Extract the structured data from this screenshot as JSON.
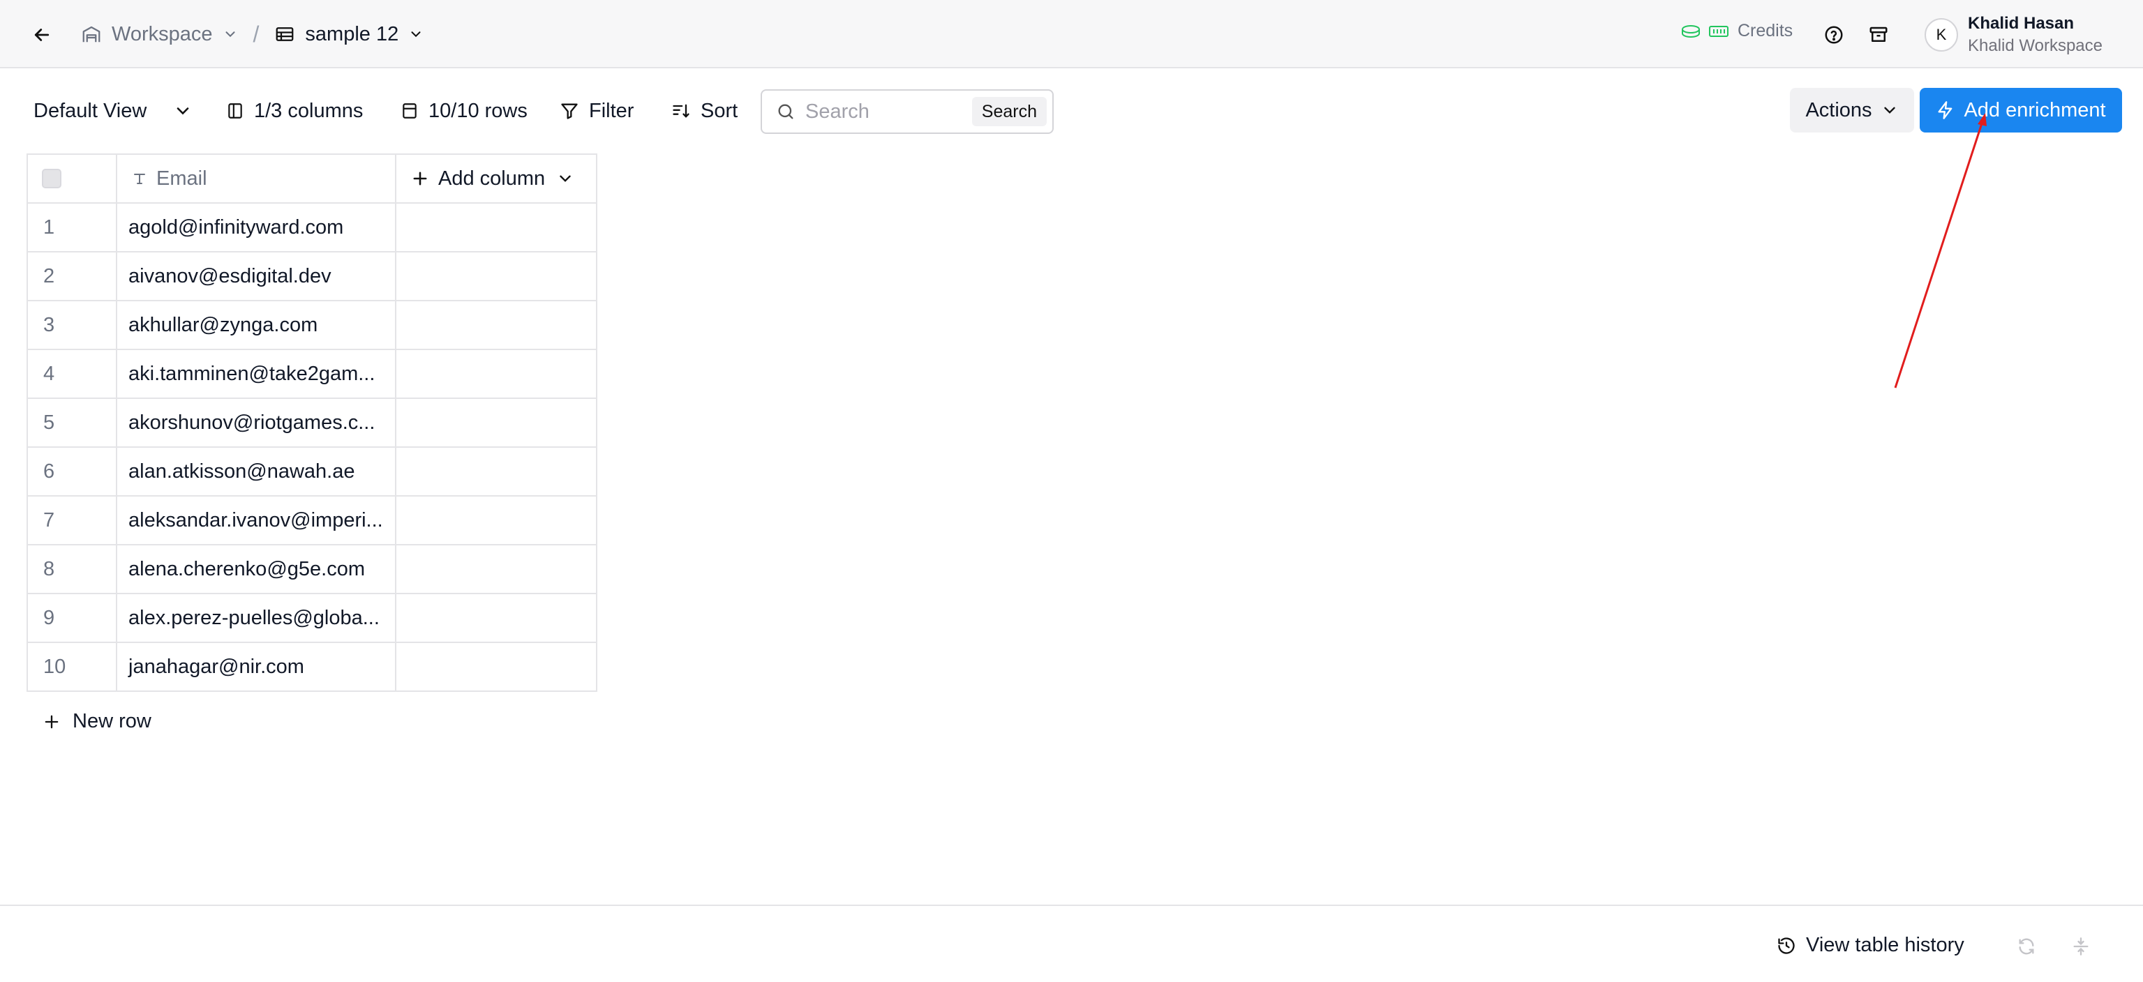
{
  "header": {
    "breadcrumb": {
      "workspace_label": "Workspace",
      "separator": "/",
      "table_label": "sample 12"
    },
    "credits_label": "Credits",
    "user": {
      "initial": "K",
      "name": "Khalid Hasan",
      "workspace": "Khalid Workspace"
    }
  },
  "toolbar": {
    "view_label": "Default View",
    "columns_label": "1/3 columns",
    "rows_label": "10/10 rows",
    "filter_label": "Filter",
    "sort_label": "Sort",
    "search_placeholder": "Search",
    "search_button_label": "Search",
    "actions_label": "Actions",
    "enrich_label": "Add enrichment"
  },
  "table": {
    "email_header": "Email",
    "add_column_label": "Add column",
    "rows": [
      {
        "num": "1",
        "email": "agold@infinityward.com"
      },
      {
        "num": "2",
        "email": "aivanov@esdigital.dev"
      },
      {
        "num": "3",
        "email": "akhullar@zynga.com"
      },
      {
        "num": "4",
        "email": "aki.tamminen@take2gam..."
      },
      {
        "num": "5",
        "email": "akorshunov@riotgames.c..."
      },
      {
        "num": "6",
        "email": "alan.atkisson@nawah.ae"
      },
      {
        "num": "7",
        "email": "aleksandar.ivanov@imperi..."
      },
      {
        "num": "8",
        "email": "alena.cherenko@g5e.com"
      },
      {
        "num": "9",
        "email": "alex.perez-puelles@globa..."
      },
      {
        "num": "10",
        "email": "janahagar@nir.com"
      }
    ],
    "new_row_label": "New row"
  },
  "footer": {
    "history_label": "View table history"
  },
  "colors": {
    "accent": "#1a86f0",
    "credits_icon": "#22c55e",
    "annotation": "#e11d1d"
  },
  "icons": {
    "back": "arrow-left-icon",
    "workspace": "warehouse-icon",
    "table": "table-icon",
    "credits": "coins-battery-icon",
    "help": "help-circle-icon",
    "archive": "archive-icon",
    "columns": "columns-icon",
    "rows": "calculator-icon",
    "filter": "funnel-icon",
    "sort": "sort-icon",
    "search": "search-icon",
    "enrich": "lightning-icon",
    "text_type": "text-type-icon",
    "history": "history-icon",
    "refresh": "refresh-icon",
    "collapse": "collapse-icon"
  }
}
